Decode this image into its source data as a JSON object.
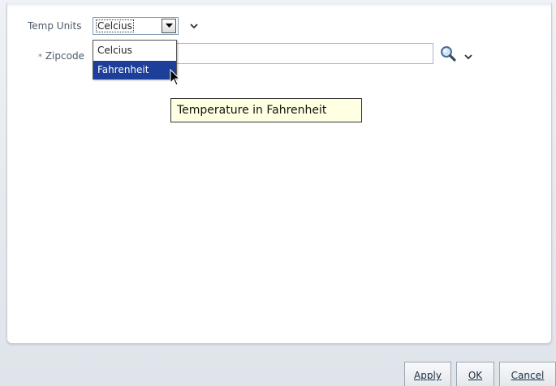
{
  "form": {
    "temp_units_label": "Temp Units",
    "temp_units_value": "Celcius",
    "temp_units_options": [
      "Celcius",
      "Fahrenheit"
    ],
    "highlighted_option": "Fahrenheit",
    "zipcode_required_marker": "*",
    "zipcode_label": "Zipcode",
    "zipcode_value": ""
  },
  "tooltip": {
    "text": "Temperature in Fahrenheit"
  },
  "buttons": {
    "apply": "Apply",
    "ok": "OK",
    "cancel": "Cancel"
  },
  "icons": {
    "select_arrow": "triangle-down-icon",
    "chevron": "chevron-down-icon",
    "search": "magnifier-icon",
    "cursor": "mouse-pointer-icon"
  },
  "colors": {
    "selected_option_bg": "#1e3f99",
    "tooltip_bg": "#ffffe1"
  }
}
